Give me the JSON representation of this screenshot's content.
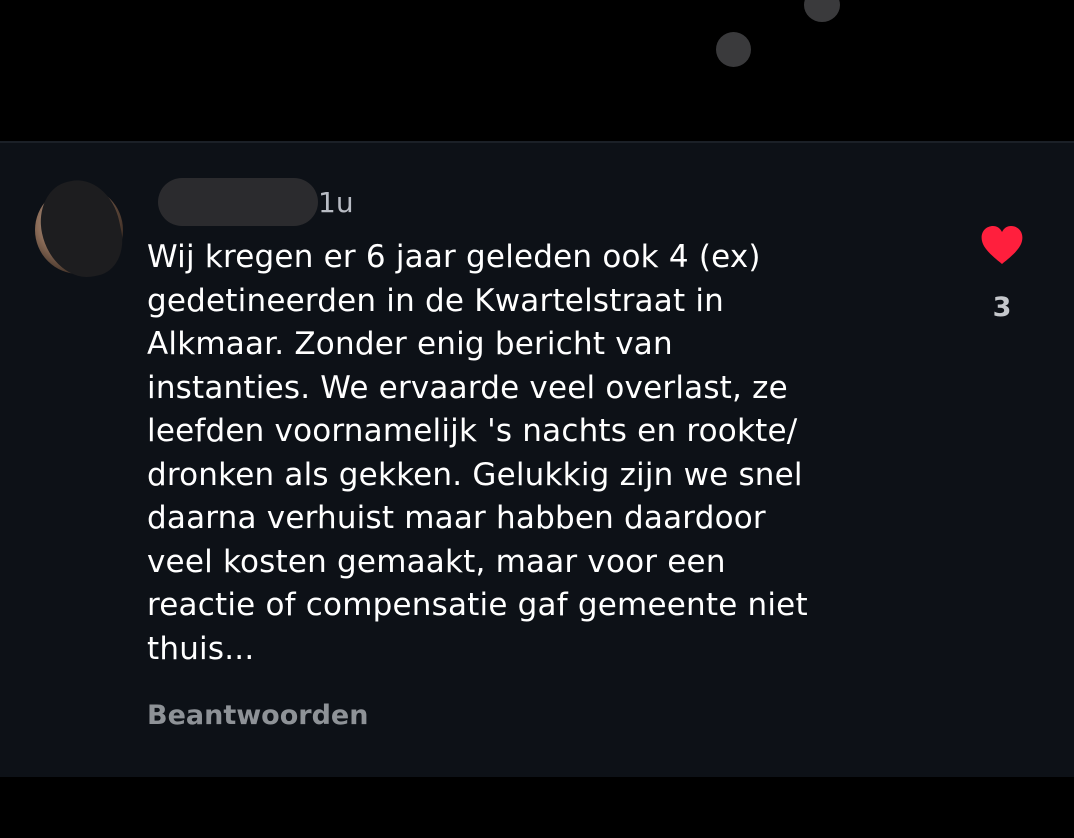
{
  "comment": {
    "timestamp": "1u",
    "lines": [
      "Wij kregen er 6 jaar geleden ook 4 (ex)",
      "gedetineerden in de Kwartelstraat in",
      "Alkmaar. Zonder enig bericht van",
      "instanties. We ervaarde veel overlast, ze",
      "leefden voornamelijk 's nachts en rookte/",
      "dronken als gekken. Gelukkig zijn we snel",
      "daarna verhuist maar habben daardoor",
      "veel kosten gemaakt, maar voor een",
      "reactie of compensatie gaf gemeente niet",
      "thuis..."
    ],
    "reply_label": "Beantwoorden",
    "like_count": "3",
    "like_icon": "heart-filled-icon",
    "like_color": "#ff1f3d"
  }
}
